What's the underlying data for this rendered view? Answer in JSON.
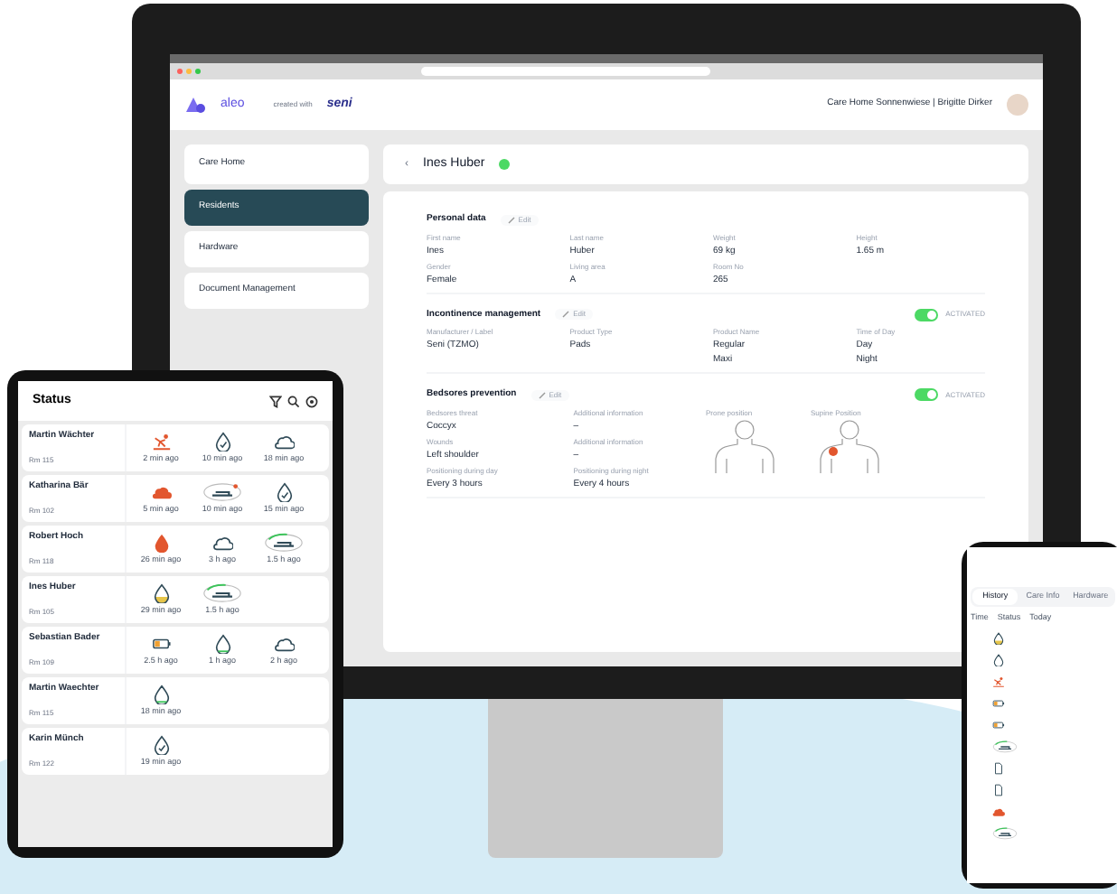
{
  "desktop": {
    "logo": "aleo",
    "created_with": "created with",
    "partner_logo": "seni",
    "account": "Care Home Sonnenwiese | Brigitte Dirker",
    "sidebar": [
      {
        "label": "Care Home",
        "selected": false
      },
      {
        "label": "Residents",
        "selected": true
      },
      {
        "label": "Hardware",
        "selected": false
      },
      {
        "label": "Document Management",
        "selected": false
      }
    ],
    "back": "‹",
    "resident": "Ines Huber",
    "sections": [
      {
        "title": "Personal data",
        "edit": "Edit",
        "fields": [
          {
            "label": "First name",
            "values": [
              "Ines"
            ]
          },
          {
            "label": "Last name",
            "values": [
              "Huber"
            ]
          },
          {
            "label": "Weight",
            "values": [
              "69 kg"
            ]
          },
          {
            "label": "Height",
            "values": [
              "1.65 m"
            ]
          },
          {
            "label": "Gender",
            "values": [
              "Female"
            ]
          },
          {
            "label": "Living area",
            "values": [
              "A"
            ]
          },
          {
            "label": "Room No",
            "values": [
              "265"
            ]
          }
        ]
      },
      {
        "title": "Incontinence management",
        "edit": "Edit",
        "toggle": {
          "on": true,
          "label": "ACTIVATED"
        },
        "fields": [
          {
            "label": "Manufacturer / Label",
            "values": [
              "Seni (TZMO)"
            ]
          },
          {
            "label": "Product Type",
            "values": [
              "Pads"
            ]
          },
          {
            "label": "Product Name",
            "values": [
              "Regular",
              "Maxi"
            ]
          },
          {
            "label": "Time of Day",
            "values": [
              "Day",
              "Night"
            ]
          }
        ]
      },
      {
        "title": "Bedsores prevention",
        "edit": "Edit",
        "toggle": {
          "on": true,
          "label": "ACTIVATED"
        },
        "fields": [
          {
            "label": "Bedsores threat",
            "values": [
              "Coccyx"
            ]
          },
          {
            "label": "Additional information",
            "values": [
              "–"
            ]
          },
          {
            "label": "Wounds",
            "values": [
              "Left shoulder"
            ]
          },
          {
            "label": "Additional information",
            "values": [
              "–"
            ]
          },
          {
            "label": "Positioning during day",
            "values": [
              "Every 3 hours"
            ]
          },
          {
            "label": "Positioning during night",
            "values": [
              "Every 4 hours"
            ]
          }
        ],
        "bodies": [
          {
            "label": "Prone position",
            "wound": false
          },
          {
            "label": "Supine Position",
            "wound": true
          }
        ]
      }
    ]
  },
  "tablet": {
    "title": "Status",
    "residents": [
      {
        "name": "Martin Wächter",
        "room": "Rm 115",
        "events": [
          {
            "kind": "fall",
            "time": "2 min ago"
          },
          {
            "kind": "drop_check",
            "time": "10 min ago"
          },
          {
            "kind": "stool",
            "time": "18 min ago"
          }
        ]
      },
      {
        "name": "Katharina Bär",
        "room": "Rm 102",
        "events": [
          {
            "kind": "stool_red",
            "time": "5 min ago"
          },
          {
            "kind": "bed_alert",
            "time": "10 min ago"
          },
          {
            "kind": "drop_check",
            "time": "15 min ago"
          }
        ]
      },
      {
        "name": "Robert Hoch",
        "room": "Rm 118",
        "events": [
          {
            "kind": "drop_red",
            "time": "26 min ago"
          },
          {
            "kind": "stool",
            "time": "3 h ago"
          },
          {
            "kind": "bed_green",
            "time": "1.5 h ago"
          }
        ]
      },
      {
        "name": "Ines Huber",
        "room": "Rm 105",
        "events": [
          {
            "kind": "drop_yellow",
            "time": "29 min ago"
          },
          {
            "kind": "bed_green",
            "time": "1.5 h ago"
          }
        ]
      },
      {
        "name": "Sebastian Bader",
        "room": "Rm 109",
        "events": [
          {
            "kind": "battery",
            "time": "2.5 h ago"
          },
          {
            "kind": "drop_green",
            "time": "1 h ago"
          },
          {
            "kind": "stool",
            "time": "2 h ago"
          }
        ]
      },
      {
        "name": "Martin Waechter",
        "room": "Rm 115",
        "events": [
          {
            "kind": "drop_green",
            "time": "18 min ago"
          }
        ]
      },
      {
        "name": "Karin Münch",
        "room": "Rm 122",
        "events": [
          {
            "kind": "drop_check",
            "time": "19 min ago"
          }
        ]
      }
    ]
  },
  "phone": {
    "tabs": [
      {
        "label": "History",
        "selected": true
      },
      {
        "label": "Care Info",
        "selected": false
      },
      {
        "label": "Hardware",
        "selected": false
      }
    ],
    "filters": [
      "Time",
      "Status",
      "Today"
    ],
    "history": [
      {
        "kind": "drop_yellow"
      },
      {
        "kind": "drop"
      },
      {
        "kind": "fall"
      },
      {
        "kind": "battery"
      },
      {
        "kind": "battery"
      },
      {
        "kind": "bed_green"
      },
      {
        "kind": "doc"
      },
      {
        "kind": "doc"
      },
      {
        "kind": "stool_red"
      },
      {
        "kind": "bed_green"
      }
    ]
  }
}
